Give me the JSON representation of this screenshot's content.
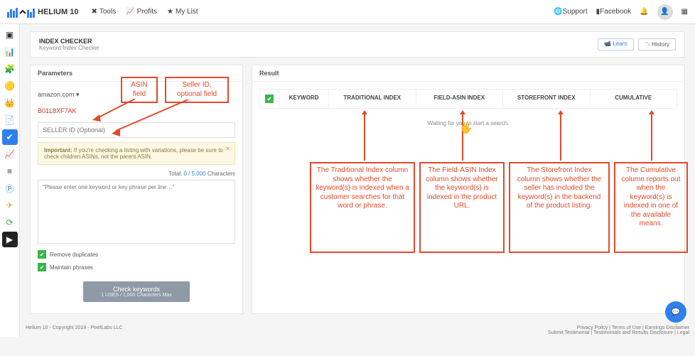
{
  "brand": "HELIUM 10",
  "topMenu": {
    "tools": "Tools",
    "profits": "Profits",
    "mylist": "My List"
  },
  "topRight": {
    "support": "Support",
    "facebook": "Facebook"
  },
  "header": {
    "title": "INDEX CHECKER",
    "sub": "Keyword Index Checker",
    "learn": "Learn",
    "history": "History"
  },
  "params": {
    "title": "Parameters",
    "market": "amazon.com ▾",
    "asin": "B01L8XF7AK",
    "sellerPh": "SELLER ID (Optional)",
    "noteBold": "Important:",
    "note": " If you're checking a listing with variations, please be sure to check children ASINs, not the parent ASIN.",
    "totalLabel": "Total: ",
    "totalCount": "0 / 5,000",
    "totalUnit": " Characters",
    "taPh": "\"Please enter one keyword or key phrase per line…\"",
    "opt1": "Remove duplicates",
    "opt2": "Maintain phrases",
    "btn": "Check keywords",
    "btnSub": "1 USES / 1,000 Characters Max"
  },
  "result": {
    "title": "Result",
    "cols": {
      "kw": "KEYWORD",
      "trad": "TRADITIONAL INDEX",
      "fasin": "FIELD-ASIN INDEX",
      "store": "STOREFRONT INDEX",
      "cum": "CUMULATIVE"
    },
    "wait": "Waiting for you to start a search."
  },
  "annot": {
    "asin": "ASIN field",
    "seller": "Seller ID, optional field",
    "trad": "The Traditional Index column shows whether the keyword(s) is indexed when a customer searches for that word or phrase.",
    "fasin": "The Field-ASIN Index column shows whether the keyword(s) is indexed in the product URL.",
    "store": "The Storefront Index column shows whether the seller has included the keyword(s) in the backend of the product listing.",
    "cum": "The Cumulative column reports out when the keyword(s) is indexed in one of the available means."
  },
  "footer": {
    "left": "Helium 10 - Copyright 2018 - PixelLabs LLC",
    "right": "Privacy Policy | Terms of Use | Earnings Disclaimer\nSubmit Testimonial | Testimonials and Results Disclosure | Legal"
  }
}
